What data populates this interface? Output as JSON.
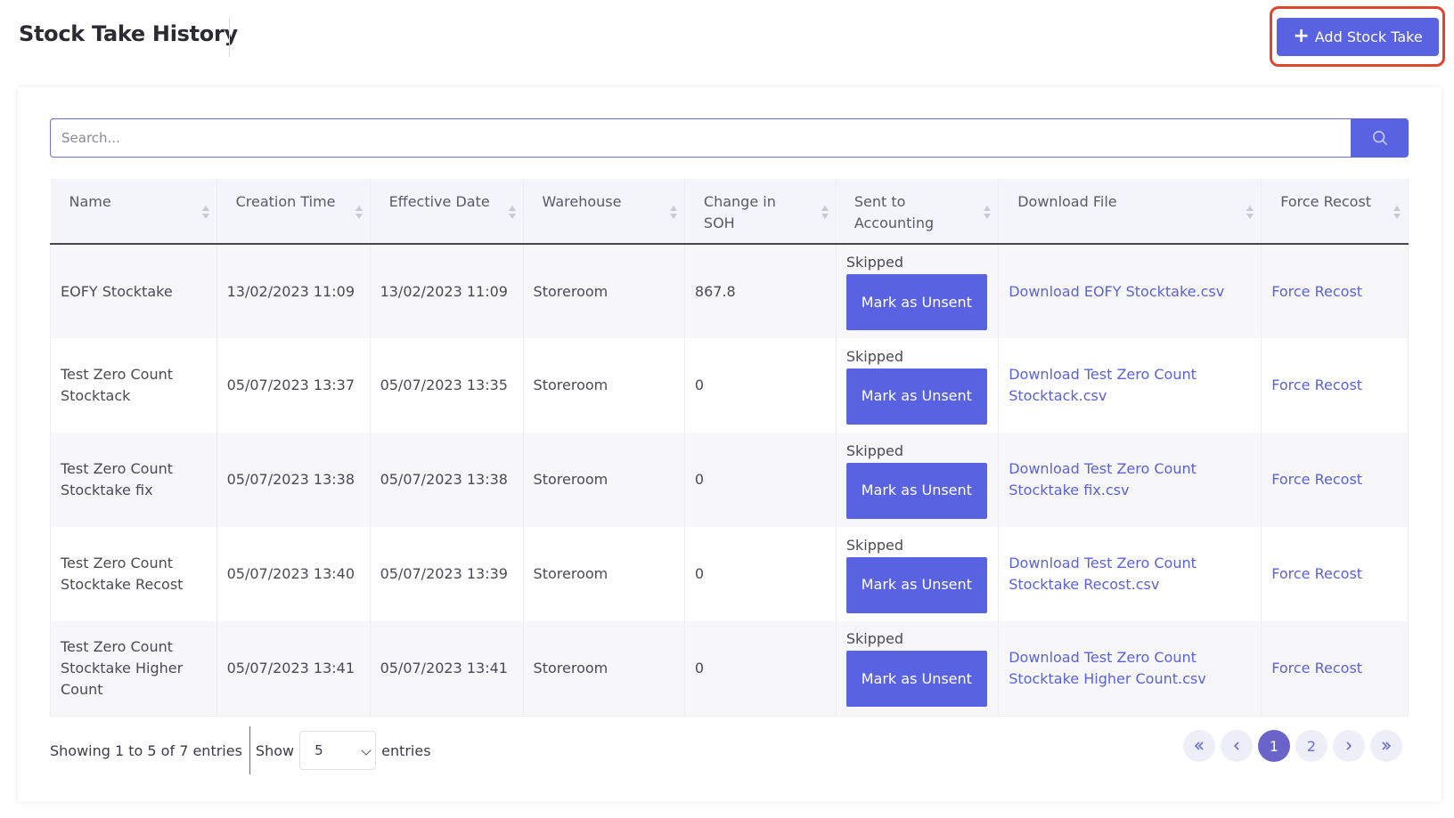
{
  "header": {
    "title": "Stock Take History",
    "add_button_label": "Add Stock Take"
  },
  "search": {
    "placeholder": "Search..."
  },
  "table": {
    "columns": [
      "Name",
      "Creation Time",
      "Effective Date",
      "Warehouse",
      "Change in SOH",
      "Sent to Accounting",
      "Download File",
      "Force Recost"
    ],
    "rows": [
      {
        "name": "EOFY Stocktake",
        "creation_time": "13/02/2023 11:09",
        "effective_date": "13/02/2023 11:09",
        "warehouse": "Storeroom",
        "change_soh": "867.8",
        "sent_status": "Skipped",
        "mark_label": "Mark as Unsent",
        "download": "Download EOFY Stocktake.csv",
        "recost": "Force Recost"
      },
      {
        "name": "Test Zero Count Stocktack",
        "creation_time": "05/07/2023 13:37",
        "effective_date": "05/07/2023 13:35",
        "warehouse": "Storeroom",
        "change_soh": "0",
        "sent_status": "Skipped",
        "mark_label": "Mark as Unsent",
        "download": "Download Test Zero Count Stocktack.csv",
        "recost": "Force Recost"
      },
      {
        "name": "Test Zero Count Stocktake fix",
        "creation_time": "05/07/2023 13:38",
        "effective_date": "05/07/2023 13:38",
        "warehouse": "Storeroom",
        "change_soh": "0",
        "sent_status": "Skipped",
        "mark_label": "Mark as Unsent",
        "download": "Download Test Zero Count Stocktake fix.csv",
        "recost": "Force Recost"
      },
      {
        "name": "Test Zero Count Stocktake Recost",
        "creation_time": "05/07/2023 13:40",
        "effective_date": "05/07/2023 13:39",
        "warehouse": "Storeroom",
        "change_soh": "0",
        "sent_status": "Skipped",
        "mark_label": "Mark as Unsent",
        "download": "Download Test Zero Count Stocktake Recost.csv",
        "recost": "Force Recost"
      },
      {
        "name": "Test Zero Count Stocktake Higher Count",
        "creation_time": "05/07/2023 13:41",
        "effective_date": "05/07/2023 13:41",
        "warehouse": "Storeroom",
        "change_soh": "0",
        "sent_status": "Skipped",
        "mark_label": "Mark as Unsent",
        "download": "Download Test Zero Count Stocktake Higher Count.csv",
        "recost": "Force Recost"
      }
    ]
  },
  "footer": {
    "showing_text": "Showing 1 to 5 of 7 entries",
    "show_label": "Show",
    "entries_value": "5",
    "entries_label": "entries"
  },
  "pagination": {
    "first_icon": "double-chevron-left-icon",
    "prev_icon": "chevron-left-icon",
    "pages": [
      "1",
      "2"
    ],
    "current_page": "1",
    "next_icon": "chevron-right-icon",
    "last_icon": "double-chevron-right-icon"
  },
  "colors": {
    "accent": "#5962e0",
    "active_page": "#6a63c9",
    "highlight_outline": "#e0442f"
  }
}
